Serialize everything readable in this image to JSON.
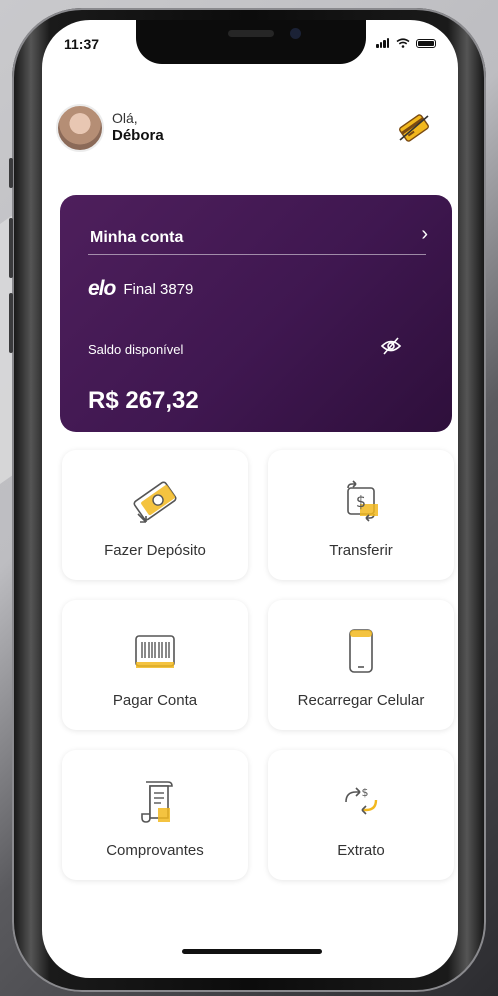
{
  "status_bar": {
    "time": "11:37"
  },
  "user": {
    "greeting": "Olá,",
    "name": "Débora"
  },
  "account_card": {
    "title": "Minha conta",
    "brand": "elo",
    "card_final": "Final 3879",
    "balance_label": "Saldo disponível",
    "balance": "R$ 267,32"
  },
  "actions": [
    {
      "label": "Fazer Depósito",
      "icon": "deposit-money-icon"
    },
    {
      "label": "Transferir",
      "icon": "transfer-money-icon"
    },
    {
      "label": "Pagar Conta",
      "icon": "barcode-icon"
    },
    {
      "label": "Recarregar Celular",
      "icon": "mobile-phone-icon"
    },
    {
      "label": "Comprovantes",
      "icon": "receipt-icon"
    },
    {
      "label": "Extrato",
      "icon": "statement-cycle-icon"
    }
  ],
  "colors": {
    "accent_purple": "#3f1750",
    "accent_yellow": "#f2b81e"
  }
}
